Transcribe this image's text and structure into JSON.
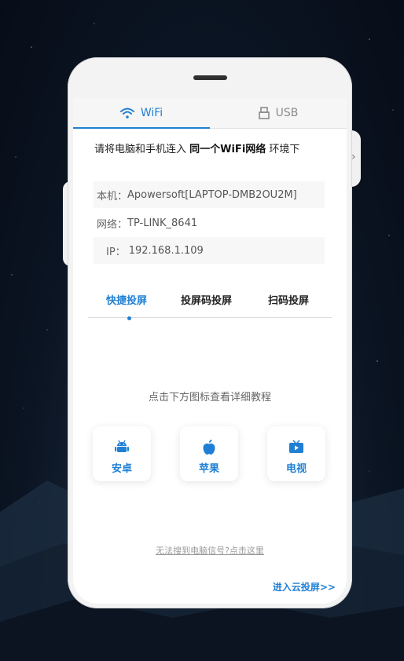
{
  "tabs": {
    "wifi_label": "WiFi",
    "usb_label": "USB"
  },
  "instruction": {
    "prefix": "请将电脑和手机连入 ",
    "emphasis": "同一个WiFi网络",
    "suffix": " 环境下"
  },
  "device": {
    "host_label": "本机：",
    "host_value": "Apowersoft[LAPTOP-DMB2OU2M]",
    "network_label": "网络：",
    "network_value": "TP-LINK_8641",
    "ip_label": "IP：",
    "ip_value": "192.168.1.109"
  },
  "modes": [
    "快捷投屏",
    "投屏码投屏",
    "扫码投屏"
  ],
  "hint": "点击下方图标查看详细教程",
  "platforms": [
    "安卓",
    "苹果",
    "电视"
  ],
  "links": {
    "no_signal": "无法搜到电脑信号?点击这里",
    "cloud": "进入云投屏>>"
  },
  "side_arrow": "›",
  "colors": {
    "accent": "#1f7fd4",
    "background": "#0b1422"
  }
}
